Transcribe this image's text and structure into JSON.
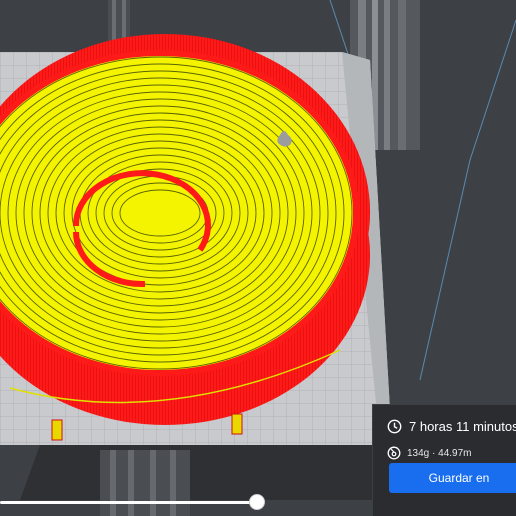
{
  "print_summary": {
    "time_label": "7 horas 11 minutos",
    "material_label": "134g · 44.97m",
    "save_button_label": "Guardar en"
  },
  "icons": {
    "time": "clock-icon",
    "material": "spool-icon"
  },
  "layer_slider": {
    "value_fraction": 0.98
  },
  "colors": {
    "infill": "#f4f400",
    "wall": "#ff1c1c",
    "build_plate": "#c8cacd",
    "accent": "#196ef0",
    "panel_bg": "#2a2c30"
  }
}
